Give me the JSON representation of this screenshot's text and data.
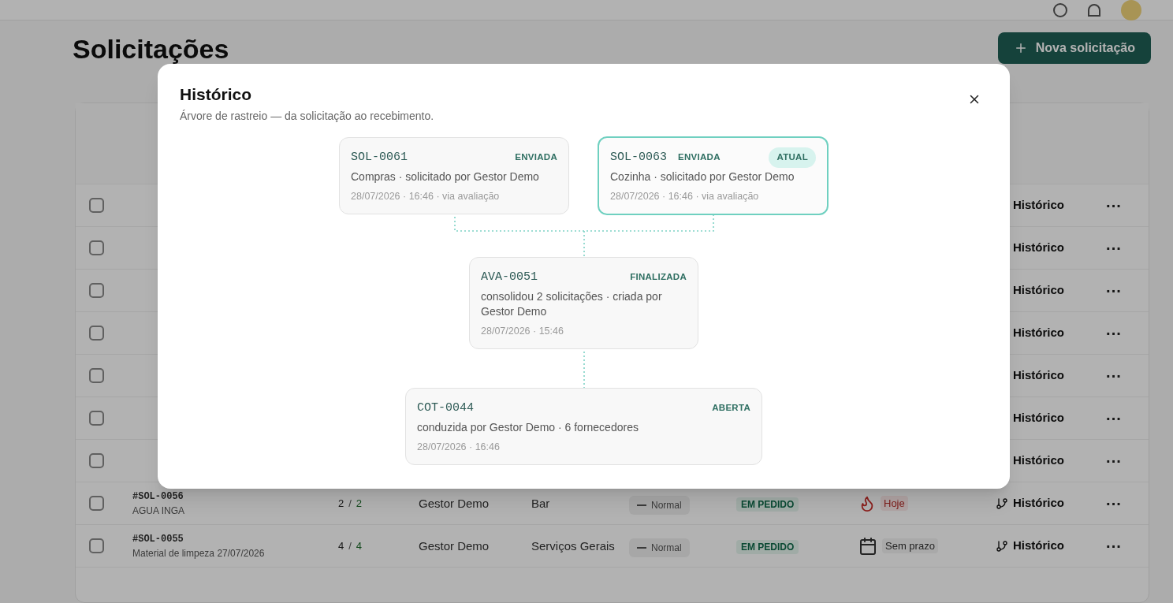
{
  "page": {
    "title": "Solicitações",
    "new_button": "Nova solicitação"
  },
  "table": {
    "rows": [
      {
        "checked": false,
        "history": "Histórico",
        "menu": "···"
      },
      {
        "checked": false,
        "history": "Histórico",
        "menu": "···"
      },
      {
        "checked": false,
        "history": "Histórico",
        "menu": "···"
      },
      {
        "checked": false,
        "history": "Histórico",
        "menu": "···"
      },
      {
        "checked": false,
        "history": "Histórico",
        "menu": "···"
      },
      {
        "checked": false,
        "history": "Histórico",
        "menu": "···"
      },
      {
        "checked": false,
        "history": "Histórico",
        "menu": "···"
      },
      {
        "checked": false,
        "code": "#SOL-0056",
        "name": "AGUA INGA",
        "qty": "2",
        "qty_sep": "/",
        "qty_done": "2",
        "requester": "Gestor Demo",
        "sector": "Bar",
        "priority": "Normal",
        "status": "EM PEDIDO",
        "deadline": "Hoje",
        "kind": "urgent",
        "history": "Histórico",
        "menu": "···"
      },
      {
        "checked": false,
        "code": "#SOL-0055",
        "name": "Material de limpeza 27/07/2026",
        "qty": "4",
        "qty_sep": "/",
        "qty_done": "4",
        "requester": "Gestor Demo",
        "sector": "Serviços Gerais",
        "priority": "Normal",
        "status": "EM PEDIDO",
        "deadline": "Sem prazo",
        "kind": "no-deadline",
        "history": "Histórico",
        "menu": "···"
      }
    ]
  },
  "dialog": {
    "title": "Histórico",
    "subtitle": "Árvore de rastreio — da solicitação ao recebimento.",
    "nodes": [
      {
        "code": "SOL-0061",
        "status": "ENVIADA",
        "current": false,
        "line": "Compras · solicitado por Gestor Demo",
        "meta": "28/07/2026 · 16:46 · via avaliação"
      },
      {
        "code": "SOL-0063",
        "status": "ENVIADA",
        "current": true,
        "badge": "ATUAL",
        "line": "Cozinha · solicitado por Gestor Demo",
        "meta": "28/07/2026 · 16:46 · via avaliação"
      },
      {
        "code": "AVA-0051",
        "status": "FINALIZADA",
        "current": false,
        "line": "consolidou 2 solicitações · criada por Gestor Demo",
        "meta": "28/07/2026 · 15:46"
      },
      {
        "code": "COT-0044",
        "status": "ABERTA",
        "current": false,
        "line": "conduzida por Gestor Demo · 6 fornecedores",
        "meta": "28/07/2026 · 16:46"
      }
    ]
  }
}
